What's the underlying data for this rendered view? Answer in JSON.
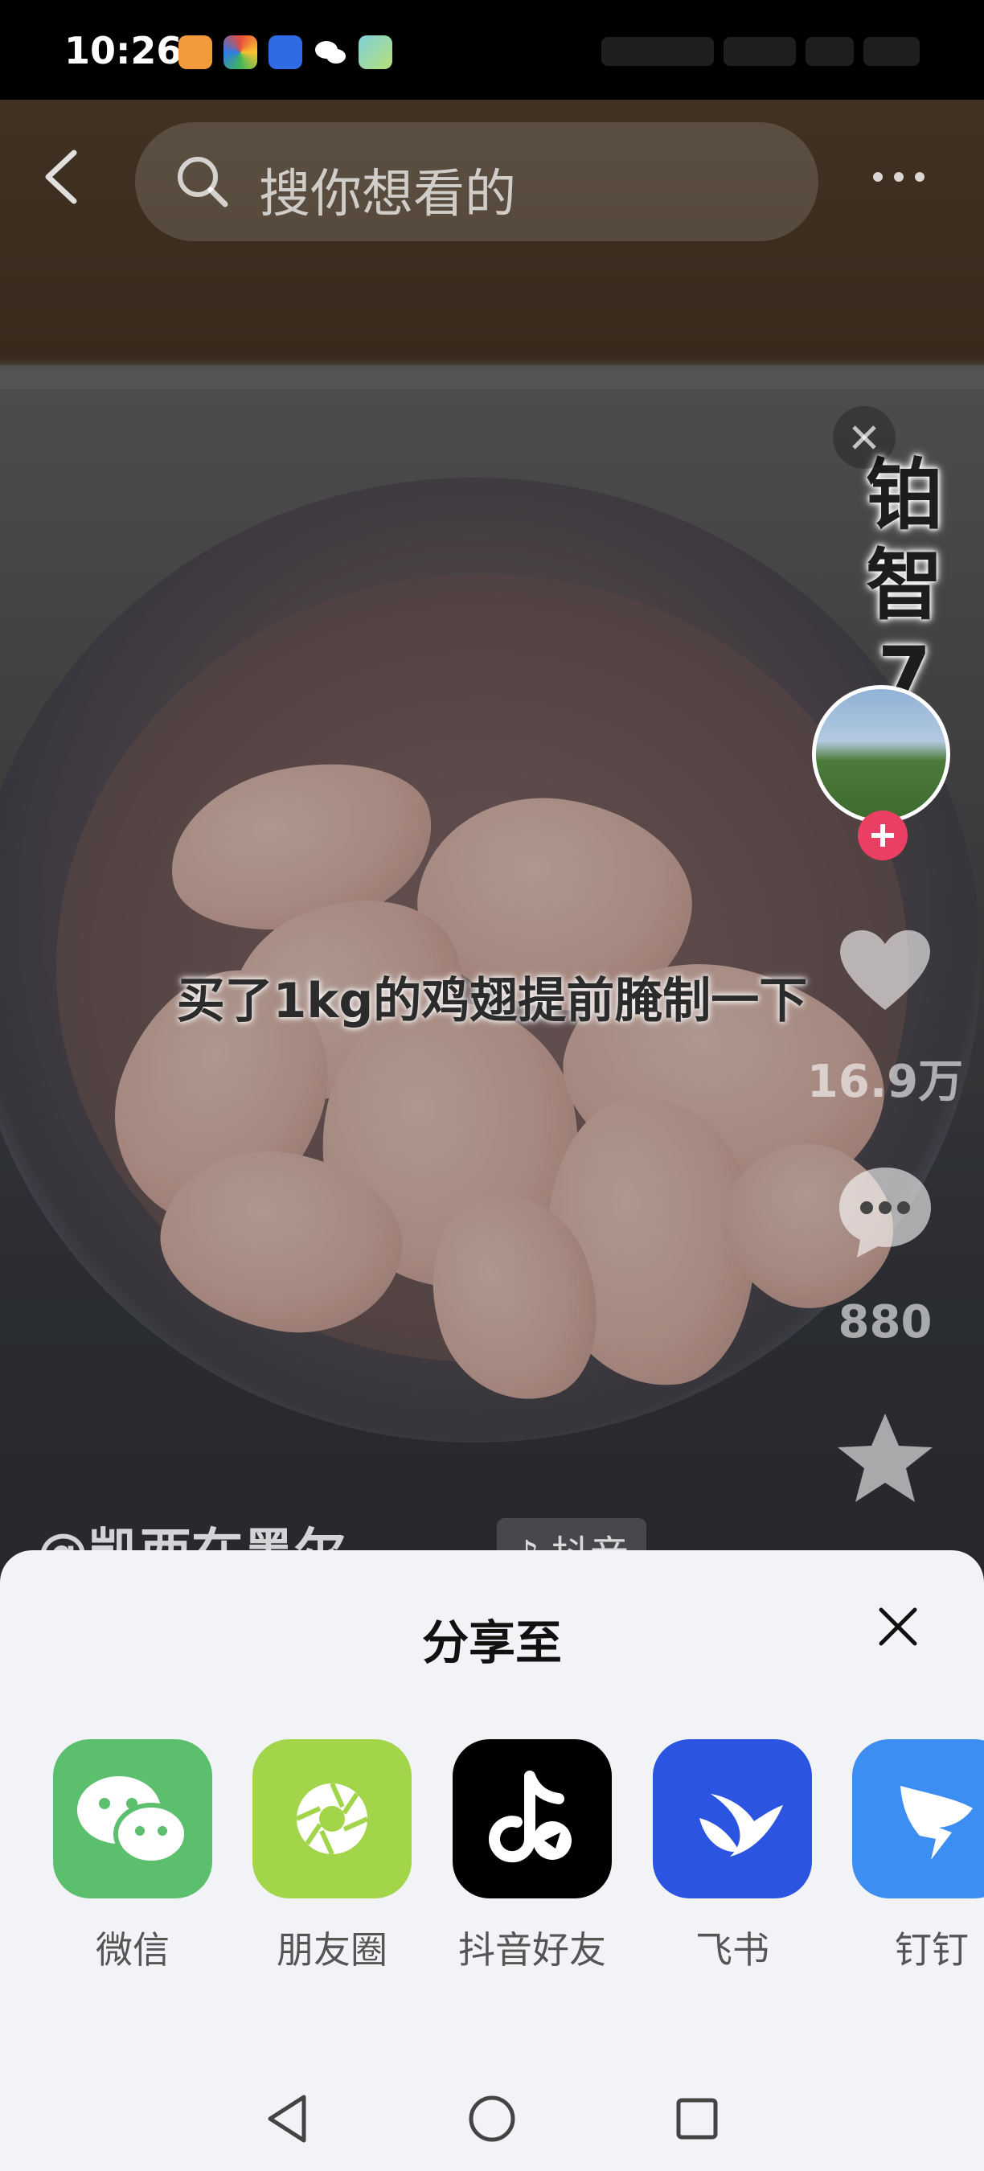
{
  "status": {
    "time": "10:26"
  },
  "search": {
    "placeholder": "搜你想看的"
  },
  "video": {
    "caption": "买了1kg的鸡翅提前腌制一下",
    "ad_text": "铂智7",
    "author": "@凯西在墨尔",
    "source_tag": "抖音",
    "likes": "16.9万",
    "comments": "880"
  },
  "share": {
    "title": "分享至",
    "targets": [
      {
        "label": "微信",
        "icon": "wechat-icon",
        "color": "#5cbf6e"
      },
      {
        "label": "朋友圈",
        "icon": "moments-icon",
        "color": "#a3d54a"
      },
      {
        "label": "抖音好友",
        "icon": "douyin-icon",
        "color": "#000000"
      },
      {
        "label": "飞书",
        "icon": "feishu-icon",
        "color": "#2b55e0"
      },
      {
        "label": "钉钉",
        "icon": "dingtalk-icon",
        "color": "#3d8ef2"
      }
    ]
  },
  "colors": {
    "follow_red": "#ea3f63",
    "sheet_bg": "#f2f3f6"
  }
}
